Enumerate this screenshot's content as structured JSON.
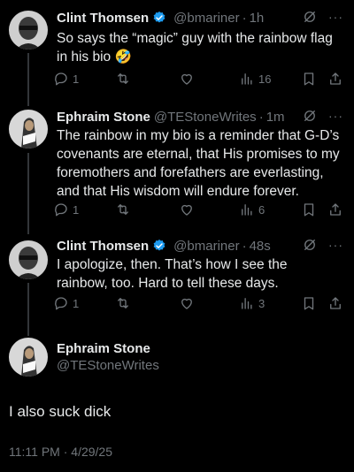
{
  "tweets": [
    {
      "name": "Clint Thomsen",
      "handle": "@bmariner",
      "time": "1h",
      "text_line1": "So says the “magic” guy with the rainbow flag",
      "text_line2": "in his bio 🤣",
      "replies": "1",
      "views": "16",
      "verified": true
    },
    {
      "name": "Ephraim Stone",
      "handle": "@TEStoneWrites",
      "time": "1m",
      "text_line1": "The rainbow in my bio is a reminder that G-D’s",
      "text_line2": "covenants are eternal, that His promises to my",
      "text_line3": "foremothers and forefathers are everlasting,",
      "text_line4": "and that His wisdom will endure forever.",
      "replies": "1",
      "views": "6",
      "verified": false
    },
    {
      "name": "Clint Thomsen",
      "handle": "@bmariner",
      "time": "48s",
      "text_line1": "I apologize, then. That’s how I see the",
      "text_line2": "rainbow, too. Hard to tell these days.",
      "replies": "1",
      "views": "3",
      "verified": true
    }
  ],
  "main": {
    "name": "Ephraim Stone",
    "handle": "@TEStoneWrites",
    "text": "I also suck dick",
    "timestamp": "11:11 PM · 4/29/25"
  },
  "colors": {
    "background": "#000000",
    "text": "#e7e9ea",
    "muted": "#71767b",
    "verified_blue": "#1d9bf0"
  }
}
